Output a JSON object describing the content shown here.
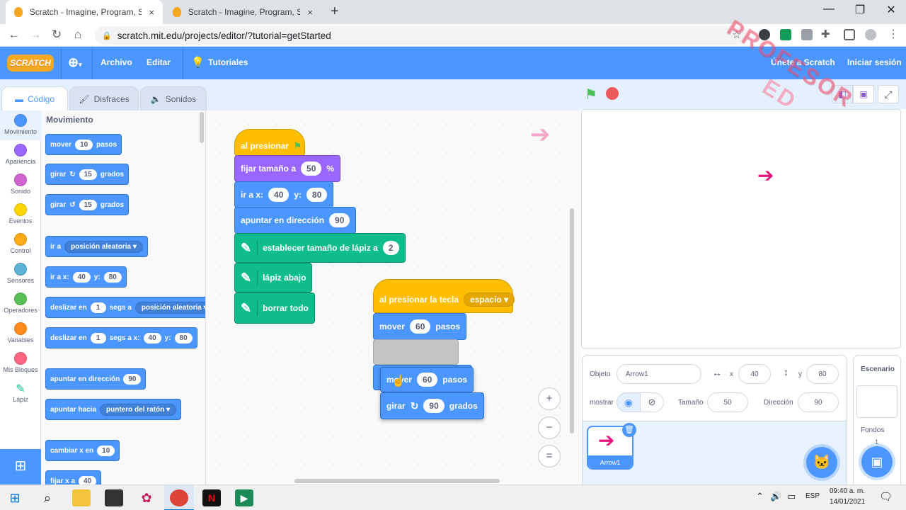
{
  "browser": {
    "tabs": [
      {
        "title": "Scratch - Imagine, Program, Shar",
        "close": "×"
      },
      {
        "title": "Scratch - Imagine, Program, Shar",
        "close": "×"
      }
    ],
    "new_tab": "+",
    "window_controls": [
      "—",
      "❐",
      "✕"
    ],
    "url": "scratch.mit.edu/projects/editor/?tutorial=getStarted"
  },
  "menubar": {
    "logo": "SCRATCH",
    "language_icon": "globe-icon",
    "file": "Archivo",
    "edit": "Editar",
    "tutorials": "Tutoriales",
    "join": "Únete a Scratch",
    "signin": "Iniciar sesión"
  },
  "editor_tabs": [
    {
      "label": "Código",
      "icon": "code-icon"
    },
    {
      "label": "Disfraces",
      "icon": "brush-icon"
    },
    {
      "label": "Sonidos",
      "icon": "speaker-icon"
    }
  ],
  "categories": [
    {
      "label": "Movimiento",
      "color": "#4c97ff"
    },
    {
      "label": "Apariencia",
      "color": "#9966ff"
    },
    {
      "label": "Sonido",
      "color": "#cf63cf"
    },
    {
      "label": "Eventos",
      "color": "#ffd500"
    },
    {
      "label": "Control",
      "color": "#ffab19"
    },
    {
      "label": "Sensores",
      "color": "#5cb1d6"
    },
    {
      "label": "Operadores",
      "color": "#59c059"
    },
    {
      "label": "Variables",
      "color": "#ff8c1a"
    },
    {
      "label": "Mis Bloques",
      "color": "#ff6680"
    },
    {
      "label": "Lápiz",
      "color": "#0fbd8c"
    }
  ],
  "palette": {
    "heading": "Movimiento",
    "move": {
      "a": "mover",
      "v": "10",
      "b": "pasos"
    },
    "turn_right": {
      "a": "girar",
      "v": "15",
      "b": "grados"
    },
    "turn_left": {
      "a": "girar",
      "v": "15",
      "b": "grados"
    },
    "goto": {
      "a": "ir a",
      "d": "posición aleatoria"
    },
    "goto_xy": {
      "a": "ir a x:",
      "x": "40",
      "b": "y:",
      "y": "80"
    },
    "glide": {
      "a": "deslizar en",
      "v": "1",
      "b": "segs a",
      "d": "posición aleatoria"
    },
    "glide_xy": {
      "a": "deslizar en",
      "v": "1",
      "b": "segs a x:",
      "x": "40",
      "c": "y:",
      "y": "80"
    },
    "point_dir": {
      "a": "apuntar en dirección",
      "v": "90"
    },
    "point_towards": {
      "a": "apuntar hacia",
      "d": "puntero del ratón"
    },
    "change_x": {
      "a": "cambiar x en",
      "v": "10"
    },
    "set_x": {
      "a": "fijar x a",
      "v": "40"
    }
  },
  "script1": {
    "hat": "al presionar",
    "set_size": {
      "a": "fijar tamaño a",
      "v": "50",
      "b": "%"
    },
    "goto_xy": {
      "a": "ir a x:",
      "x": "40",
      "b": "y:",
      "y": "80"
    },
    "point": {
      "a": "apuntar en dirección",
      "v": "90"
    },
    "pen_size": {
      "a": "establecer tamaño de lápiz a",
      "v": "2"
    },
    "pen_down": "lápiz abajo",
    "clear": "borrar todo"
  },
  "script2": {
    "hat": {
      "a": "al presionar la tecla",
      "d": "espacio"
    },
    "move": {
      "a": "mover",
      "v": "60",
      "b": "pasos"
    },
    "drag_move": {
      "a": "mover",
      "v": "60",
      "b": "pasos"
    },
    "drag_turn": {
      "a": "girar",
      "v": "90",
      "b": "grados"
    }
  },
  "sprite_info": {
    "label_sprite": "Objeto",
    "sprite_name": "Arrow1",
    "label_x": "x",
    "x": "40",
    "label_y": "y",
    "y": "80",
    "label_show": "mostrar",
    "label_size": "Tamaño",
    "size": "50",
    "label_direction": "Dirección",
    "direction": "90"
  },
  "sprite_list": [
    {
      "name": "Arrow1"
    }
  ],
  "stage_panel": {
    "title": "Escenario",
    "backdrops_label": "Fondos",
    "backdrops_count": "1"
  },
  "watermark": {
    "line1": "PROFESOR",
    "line2": "ED"
  },
  "taskbar": {
    "lang": "ESP",
    "time": "09:40 a. m.",
    "date": "14/01/2021"
  },
  "colors": {
    "scratch_blue": "#4c97ff",
    "motion": "#4c97ff",
    "looks": "#9966ff",
    "events": "#ffbf00",
    "pen": "#0fbd8c",
    "arrow": "#e6157e"
  }
}
